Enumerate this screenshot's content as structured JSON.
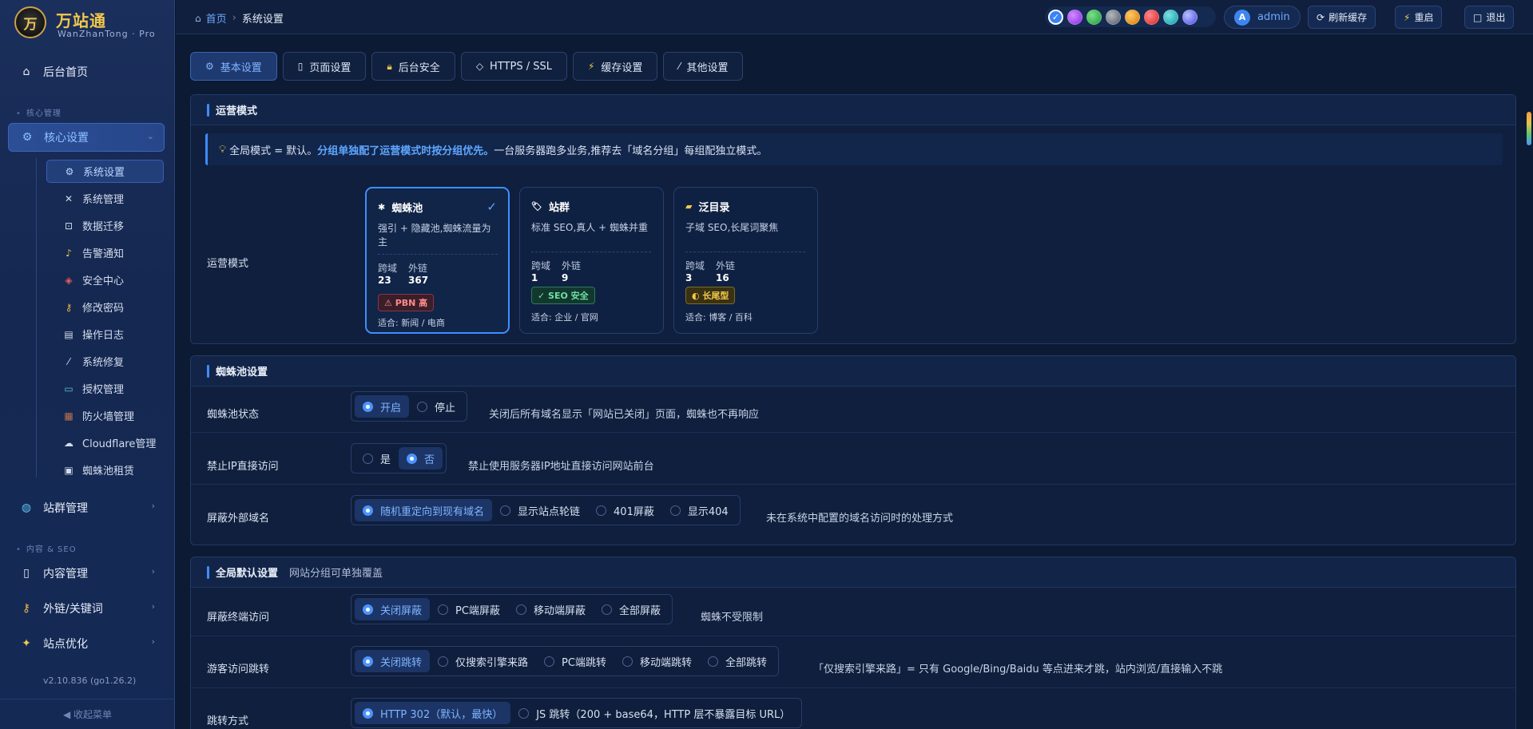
{
  "brand": {
    "badge": "万",
    "title": "万站通",
    "subtitle": "WanZhanTong · Pro"
  },
  "sidebar": {
    "home": "后台首页",
    "section_core": "核心管理",
    "core_group": "核心设置",
    "sub_items": [
      "系统设置",
      "系统管理",
      "数据迁移",
      "告警通知",
      "安全中心",
      "修改密码",
      "操作日志",
      "系统修复",
      "授权管理",
      "防火墙管理",
      "Cloudflare管理",
      "蜘蛛池租赁"
    ],
    "site_group": "站群管理",
    "section_content": "内容 & SEO",
    "content_group": "内容管理",
    "links_group": "外链/关键词",
    "opt_group": "站点优化",
    "version": "v2.10.836 (go1.26.2)",
    "collapse": "◀  收起菜单"
  },
  "topbar": {
    "crumb_home": "首页",
    "crumb_current": "系统设置",
    "theme_colors": [
      "#3b82f6",
      "#a855f7",
      "#22c55e",
      "#6b7280",
      "#f59e0b",
      "#ef4444",
      "#14b8a6",
      "#6366f1"
    ],
    "avatar_letter": "A",
    "user": "admin",
    "refresh": "刷新缓存",
    "restart": "重启",
    "logout": "退出"
  },
  "tabs": [
    "基本设置",
    "页面设置",
    "后台安全",
    "HTTPS / SSL",
    "缓存设置",
    "其他设置"
  ],
  "ops": {
    "title": "运营模式",
    "tip_prefix": "全局模式 = 默认。",
    "tip_highlight": "分组单独配了运营模式时按分组优先。",
    "tip_suffix": "一台服务器跑多业务,推荐去「域名分组」每组配独立模式。",
    "row_label": "运营模式",
    "modes": [
      {
        "name": "蜘蛛池",
        "desc": "强引 + 隐藏池,蜘蛛流量为主",
        "k1": "跨域",
        "v1": "23",
        "k2": "外链",
        "v2": "367",
        "tag": "⚠ PBN 高",
        "fit": "适合: 新闻 / 电商"
      },
      {
        "name": "站群",
        "desc": "标准 SEO,真人 + 蜘蛛并重",
        "k1": "跨域",
        "v1": "1",
        "k2": "外链",
        "v2": "9",
        "tag": "✓ SEO 安全",
        "fit": "适合: 企业 / 官网"
      },
      {
        "name": "泛目录",
        "desc": "子域 SEO,长尾词聚焦",
        "k1": "跨域",
        "v1": "3",
        "k2": "外链",
        "v2": "16",
        "tag": "◐ 长尾型",
        "fit": "适合: 博客 / 百科"
      }
    ]
  },
  "spider": {
    "title": "蜘蛛池设置",
    "status_label": "蜘蛛池状态",
    "status_opts": [
      "开启",
      "停止"
    ],
    "status_hint": "关闭后所有域名显示「网站已关闭」页面，蜘蛛也不再响应",
    "ip_label": "禁止IP直接访问",
    "ip_opts": [
      "是",
      "否"
    ],
    "ip_hint": "禁止使用服务器IP地址直接访问网站前台",
    "ext_label": "屏蔽外部域名",
    "ext_opts": [
      "随机重定向到现有域名",
      "显示站点轮链",
      "401屏蔽",
      "显示404"
    ],
    "ext_hint": "未在系统中配置的域名访问时的处理方式"
  },
  "global": {
    "title": "全局默认设置",
    "subtitle": "网站分组可单独覆盖",
    "term_label": "屏蔽终端访问",
    "term_opts": [
      "关闭屏蔽",
      "PC端屏蔽",
      "移动端屏蔽",
      "全部屏蔽"
    ],
    "term_hint": "蜘蛛不受限制",
    "jump_label": "游客访问跳转",
    "jump_opts": [
      "关闭跳转",
      "仅搜索引擎来路",
      "PC端跳转",
      "移动端跳转",
      "全部跳转"
    ],
    "jump_hint": "「仅搜索引擎来路」= 只有 Google/Bing/Baidu 等点进来才跳，站内浏览/直接输入不跳",
    "way_label": "跳转方式",
    "way_opts": [
      "HTTP 302（默认，最快）",
      "JS 跳转（200 + base64，HTTP 层不暴露目标 URL）"
    ]
  }
}
